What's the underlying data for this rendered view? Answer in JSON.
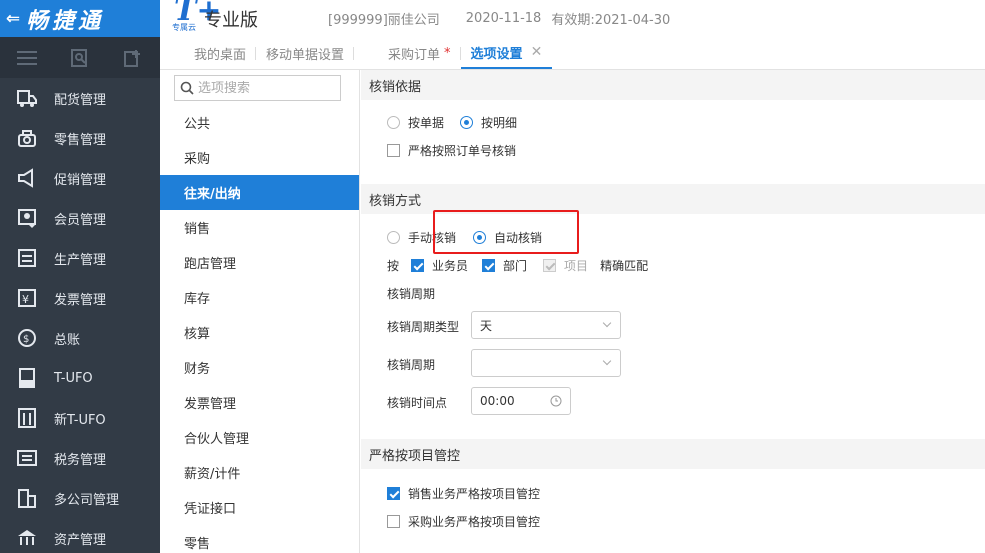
{
  "header": {
    "brand_name": "畅捷通",
    "logo_mark": "T+",
    "logo_sub": "专属云",
    "edition": "专业版",
    "company": "[999999]丽佳公司",
    "date": "2020-11-18",
    "expiry": "有效期:2021-04-30"
  },
  "sidebar": {
    "items": [
      {
        "label": "配货管理",
        "icon": "truck-icon"
      },
      {
        "label": "零售管理",
        "icon": "cashier-icon"
      },
      {
        "label": "促销管理",
        "icon": "megaphone-icon"
      },
      {
        "label": "会员管理",
        "icon": "member-card-icon"
      },
      {
        "label": "生产管理",
        "icon": "production-icon"
      },
      {
        "label": "发票管理",
        "icon": "invoice-icon"
      },
      {
        "label": "总账",
        "icon": "ledger-icon"
      },
      {
        "label": "T-UFO",
        "icon": "ufo-report-icon"
      },
      {
        "label": "新T-UFO",
        "icon": "new-ufo-icon"
      },
      {
        "label": "税务管理",
        "icon": "tax-icon"
      },
      {
        "label": "多公司管理",
        "icon": "multi-company-icon"
      },
      {
        "label": "资产管理",
        "icon": "asset-icon"
      }
    ]
  },
  "tabs": [
    {
      "label": "我的桌面",
      "dirty": false,
      "active": false
    },
    {
      "label": "移动单据设置",
      "dirty": false,
      "active": false
    },
    {
      "label": "采购订单",
      "dirty": true,
      "active": false
    },
    {
      "label": "选项设置",
      "dirty": false,
      "active": true
    }
  ],
  "dirty_mark": "*",
  "close_glyph": "✕",
  "options": {
    "search_placeholder": "选项搜索",
    "items": [
      "公共",
      "采购",
      "往来/出纳",
      "销售",
      "跑店管理",
      "库存",
      "核算",
      "财务",
      "发票管理",
      "合伙人管理",
      "薪资/计件",
      "凭证接口",
      "零售"
    ],
    "active_index": 2
  },
  "content": {
    "basis": {
      "title": "核销依据",
      "radio_doc": "按单据",
      "radio_detail": "按明细",
      "selected": "按明细",
      "strict_order": "严格按照订单号核销",
      "strict_order_checked": false
    },
    "method": {
      "title": "核销方式",
      "radio_manual": "手动核销",
      "radio_auto": "自动核销",
      "selected": "自动核销",
      "by_label": "按",
      "cb_salesman": "业务员",
      "cb_dept": "部门",
      "cb_project": "项目",
      "exact_match": "精确匹配",
      "period_label": "核销周期",
      "period_type_label": "核销周期类型",
      "period_type_value": "天",
      "period_field_label": "核销周期",
      "period_field_value": "",
      "time_label": "核销时间点",
      "time_value": "00:00"
    },
    "project": {
      "title": "严格按项目管控",
      "sales_label": "销售业务严格按项目管控",
      "sales_checked": true,
      "purchase_label": "采购业务严格按项目管控",
      "purchase_checked": false
    }
  },
  "colors": {
    "brand_blue": "#1f7fd8",
    "sidebar_bg": "#323b46",
    "highlight_red": "#e81c1c"
  }
}
